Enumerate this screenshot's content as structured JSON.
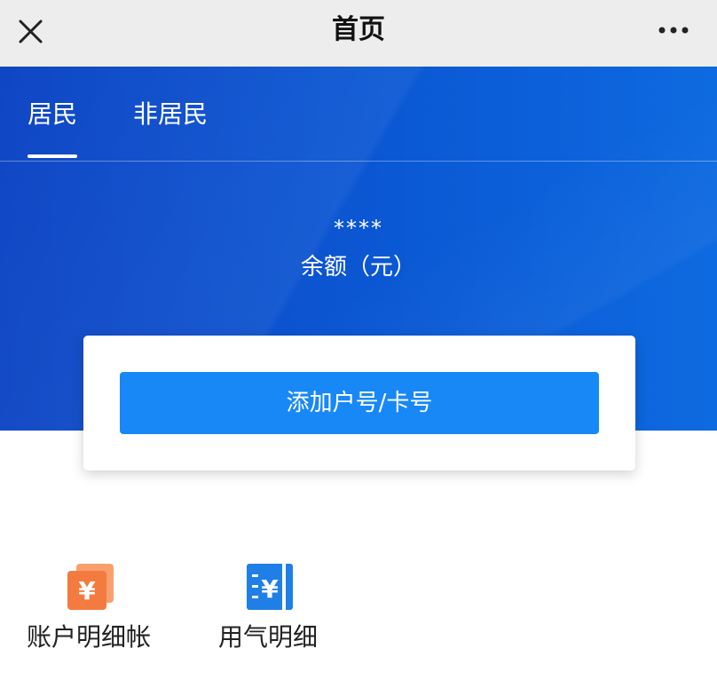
{
  "header": {
    "title": "首页",
    "close_icon": "close-icon",
    "more_icon": "more-icon"
  },
  "tabs": [
    {
      "label": "居民",
      "active": true
    },
    {
      "label": "非居民",
      "active": false
    }
  ],
  "balance": {
    "value": "****",
    "label": "余额（元）"
  },
  "card": {
    "add_button_label": "添加户号/卡号"
  },
  "features": [
    {
      "label": "账户明细帐",
      "icon": "account-ledger-icon",
      "color": "#f47b3f"
    },
    {
      "label": "用气明细",
      "icon": "gas-usage-icon",
      "color": "#1f7fe6"
    }
  ],
  "colors": {
    "titlebar_bg": "#ededed",
    "hero_blue": "#0b58d4",
    "button_blue": "#1888f7",
    "orange": "#f47b3f"
  }
}
